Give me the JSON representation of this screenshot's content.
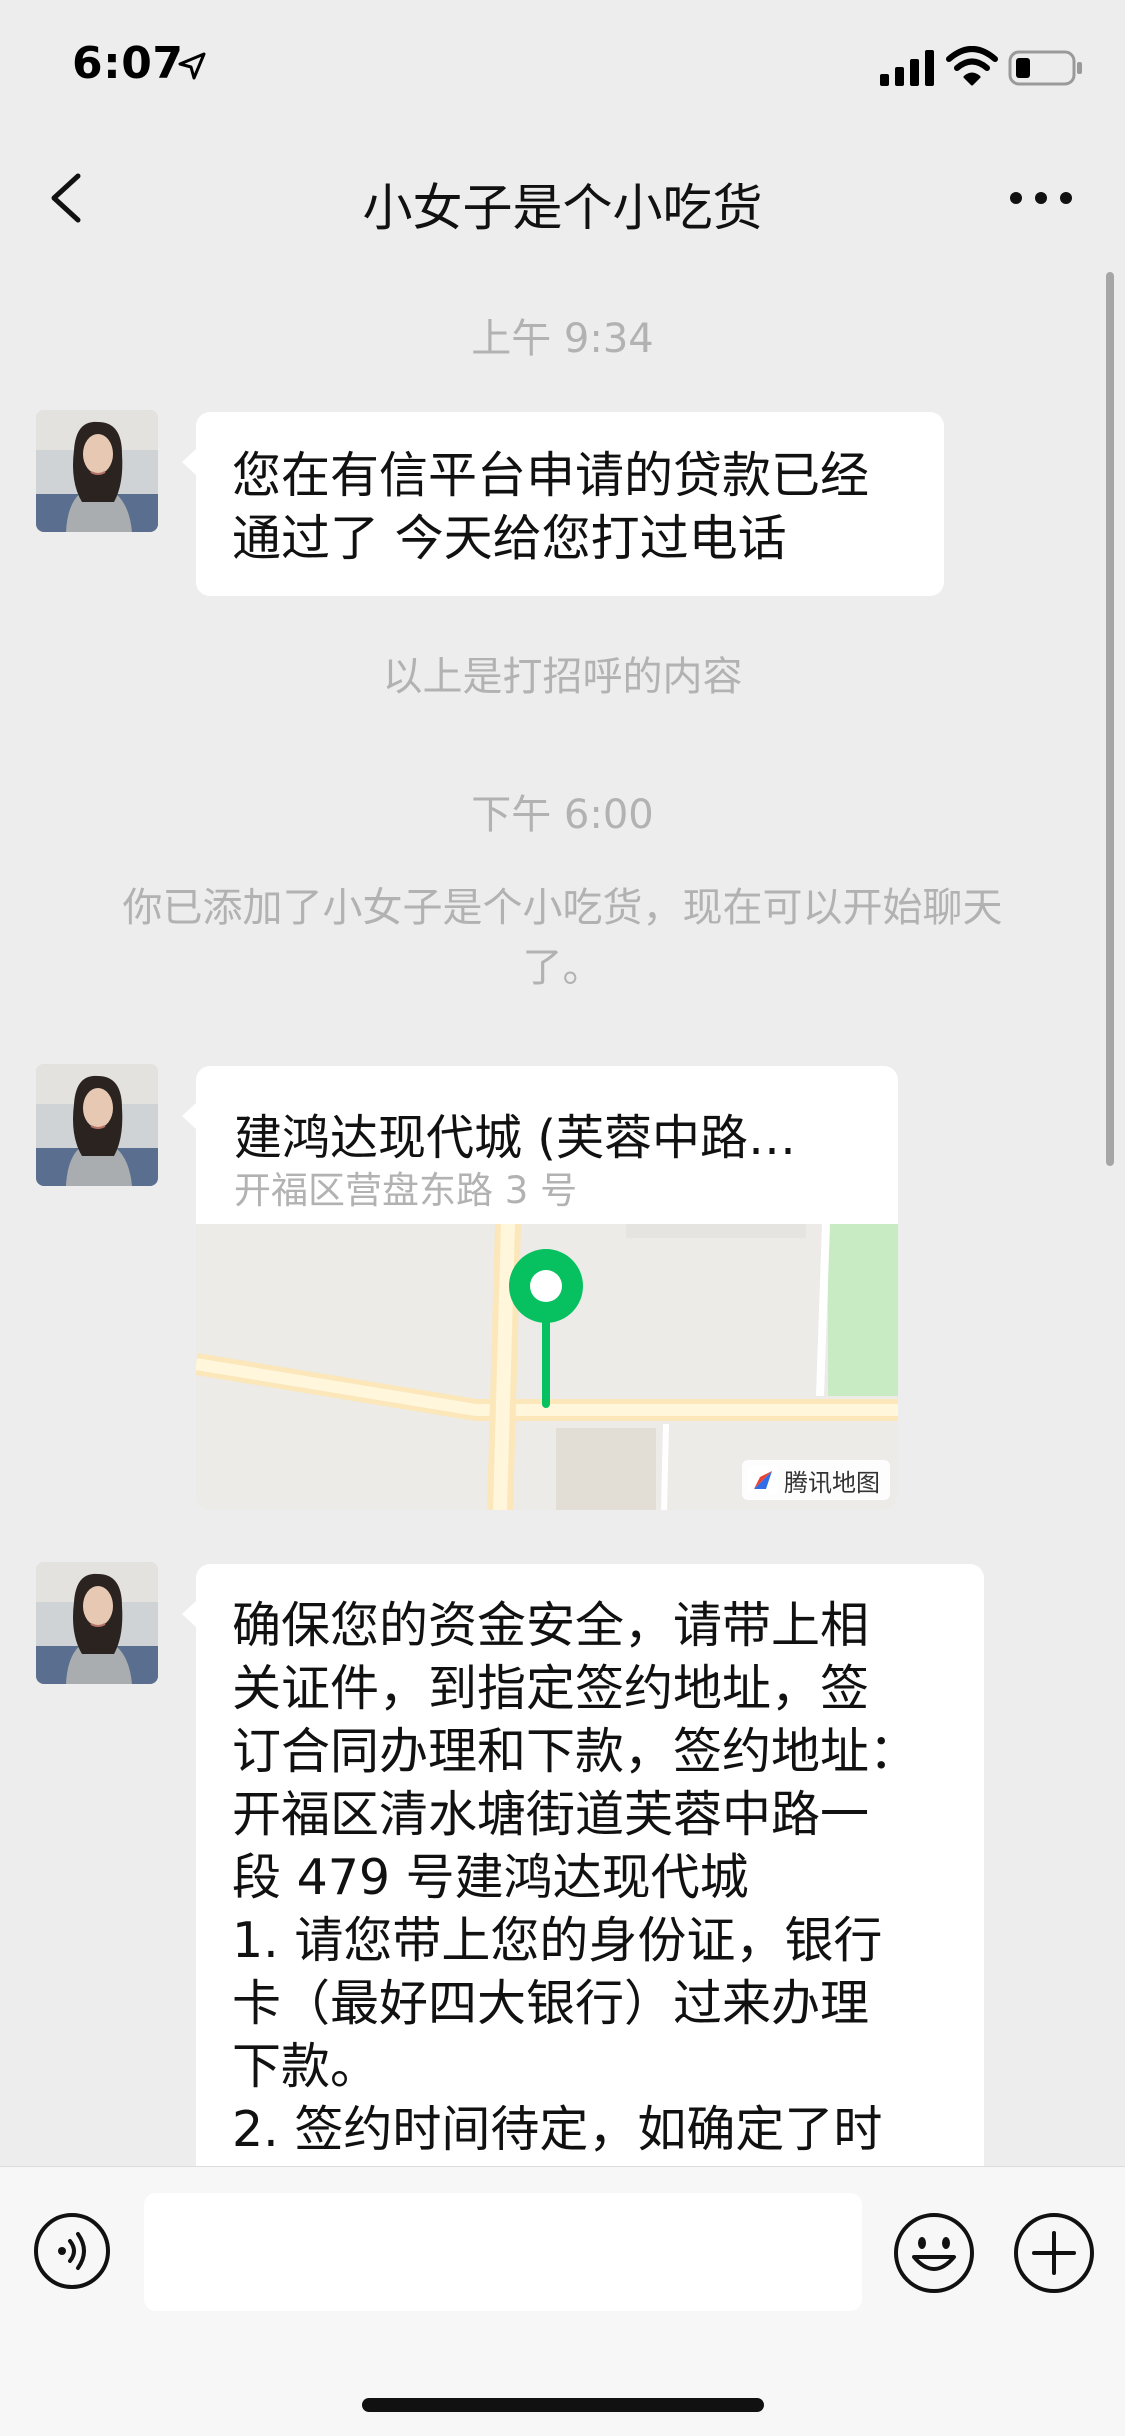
{
  "status_bar": {
    "time": "6:07"
  },
  "nav": {
    "title": "小女子是个小吃货"
  },
  "chat": {
    "timestamp_1": "上午 9:34",
    "message_1": "您在有信平台申请的贷款已经\n通过了 今天给您打过电话",
    "greeting_note": "以上是打招呼的内容",
    "timestamp_2": "下午 6:00",
    "added_notice": "你已添加了小女子是个小吃货，现在可以开始聊天\n了。",
    "location": {
      "title": "建鸿达现代城 (芙蓉中路…",
      "address": "开福区营盘东路 3 号",
      "map_provider": "腾讯地图"
    },
    "message_3": "确保您的资金安全，请带上相\n关证件，到指定签约地址，签\n订合同办理和下款，签约地址：\n开福区清水塘街道芙蓉中路一\n段 479 号建鸿达现代城\n1. 请您带上您的身份证，银行\n卡（最好四大银行）过来办理\n下款。\n2. 签约时间待定，如确定了时"
  },
  "input_bar": {
    "text_value": ""
  },
  "colors": {
    "background": "#ededed",
    "bubble": "#ffffff",
    "system_text": "#b2b2b2",
    "pin_green": "#07c160"
  }
}
